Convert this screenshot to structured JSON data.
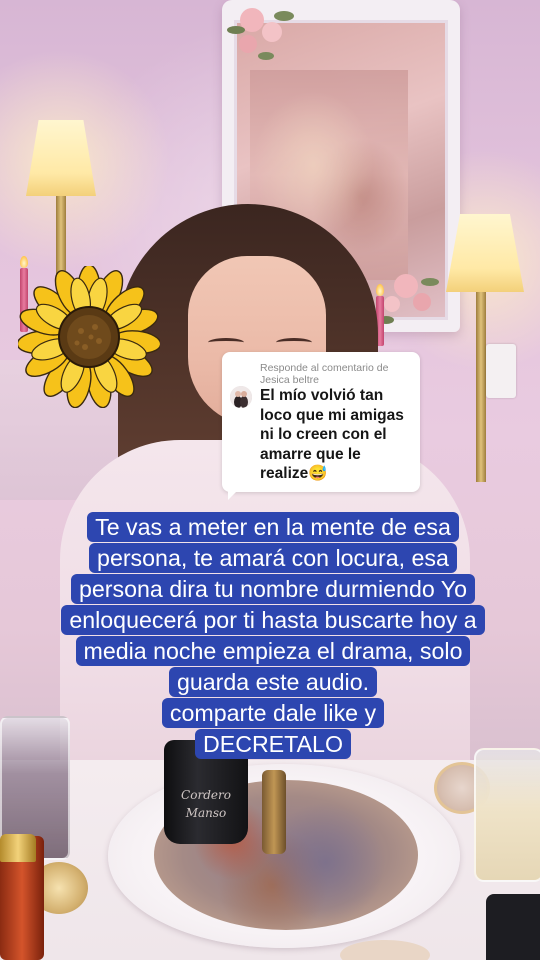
{
  "reply_card": {
    "header": "Responde al comentario de Jesica beltre",
    "comment": "El mío volvió tan loco que mi amigas ni lo creen con el amarre que le realize😅"
  },
  "caption": {
    "lines": [
      "Te vas a meter en la mente de esa",
      "persona, te amará con locura, esa",
      "persona dira tu nombre durmiendo Yo",
      "enloquecerá por ti hasta buscarte hoy a",
      "media noche empieza el drama, solo",
      "guarda este audio.",
      "comparte dale like y",
      "DECRETALO"
    ]
  },
  "bottle_label": "Cordero Manso",
  "colors": {
    "caption_background": "#2d46b0",
    "caption_text": "#ffffff",
    "card_background": "#ffffff"
  },
  "icons": {
    "sticker": "sunflower-icon",
    "avatar": "commenter-avatar"
  }
}
